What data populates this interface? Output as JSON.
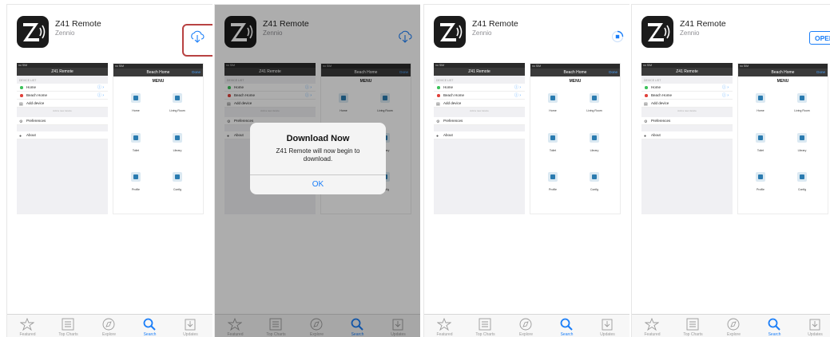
{
  "app": {
    "name": "Z41 Remote",
    "developer": "Zennio"
  },
  "open_label": "OPEN",
  "alert": {
    "title": "Download Now",
    "message": "Z41 Remote will now begin to download.",
    "ok": "OK"
  },
  "preview_left": {
    "status": "no SIM",
    "nav_title": "Z41 Remote",
    "section": "DEVICE LIST",
    "items": [
      "Home",
      "Beach Home",
      "Add device"
    ],
    "note": "Add a new device",
    "prefs": "Preferences",
    "about": "About"
  },
  "preview_right": {
    "status": "no SIM",
    "nav_title": "Beach Home",
    "done": "Done",
    "menu": "MENU",
    "tiles": [
      "Home",
      "Living Room",
      "Toilet",
      "Library",
      "Profile",
      "Config"
    ]
  },
  "tabs": [
    "Featured",
    "Top Charts",
    "Explore",
    "Search",
    "Updates"
  ],
  "colors": {
    "accent": "#1a7ef8",
    "highlight": "#b84242",
    "green": "#3cc25a",
    "red": "#e0403a"
  }
}
